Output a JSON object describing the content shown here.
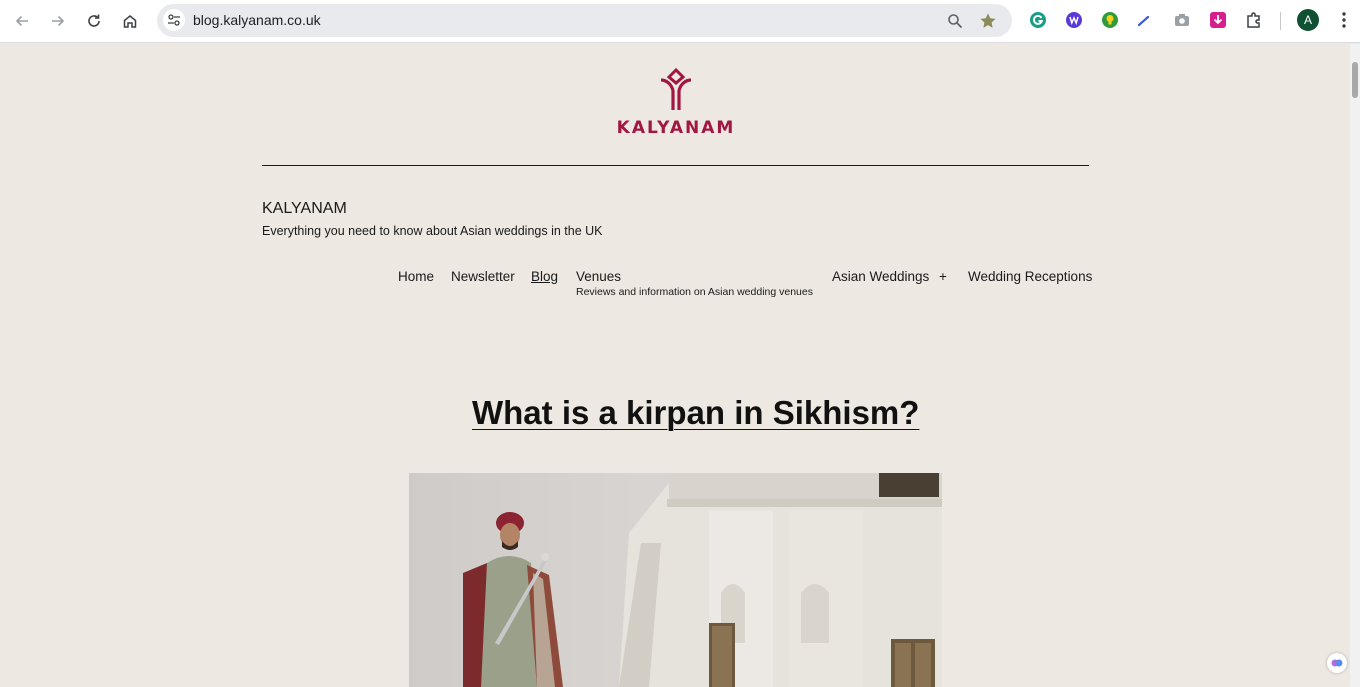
{
  "browser": {
    "url": "blog.kalyanam.co.uk",
    "profile_initial": "A",
    "icons": [
      "back-arrow-icon",
      "forward-arrow-icon",
      "reload-icon",
      "home-icon",
      "site-info-icon",
      "zoom-icon",
      "bookmark-star-icon",
      "grammarly-icon",
      "extension-w-icon",
      "lightbulb-extension-icon",
      "pen-extension-icon",
      "camera-icon",
      "download-extension-icon",
      "extensions-puzzle-icon",
      "menu-kebab-icon"
    ]
  },
  "colors": {
    "brand": "#a21742",
    "page_bg": "#ede8e2",
    "text": "#1a1a1a"
  },
  "header": {
    "logo_text": "KALYANAM",
    "site_title": "KALYANAM",
    "tagline": "Everything you need to know about Asian weddings in the UK"
  },
  "menu": {
    "items": [
      {
        "label": "Home"
      },
      {
        "label": "Newsletter"
      },
      {
        "label": "Blog",
        "active": true
      },
      {
        "label": "Venues",
        "description": "Reviews and information on Asian wedding venues"
      },
      {
        "label": "Asian Weddings",
        "submenu_toggle": "+"
      },
      {
        "label": "Wedding Receptions"
      }
    ]
  },
  "post": {
    "title": "What is a kirpan in Sikhism?"
  }
}
